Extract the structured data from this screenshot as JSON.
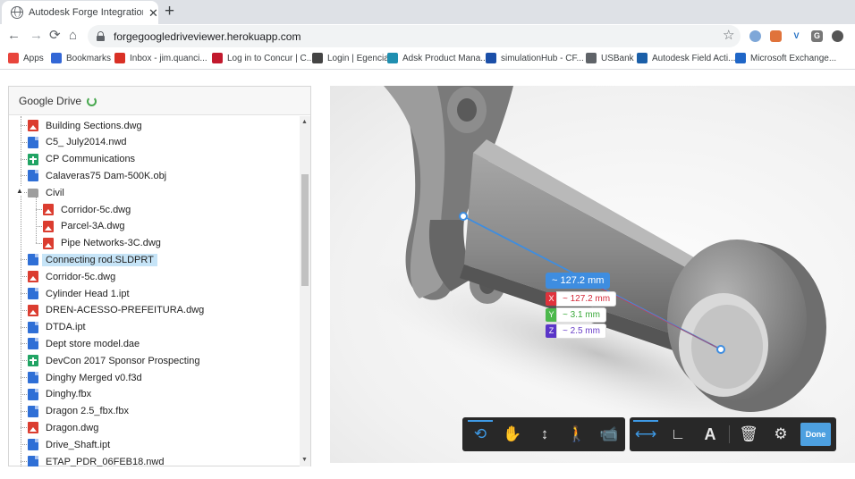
{
  "browser": {
    "tab_title": "Autodesk Forge Integration with",
    "close_glyph": "✕",
    "new_tab_glyph": "+",
    "url": "forgegoogledriveviewer.herokuapp.com",
    "nav": {
      "back": "←",
      "forward": "→",
      "reload": "⟳",
      "home": "⌂",
      "star": "☆"
    },
    "extensions": [
      {
        "icon": "extension-circle-icon",
        "letter": "",
        "color": "#7ea7d8"
      },
      {
        "icon": "extension-fox-icon",
        "letter": "",
        "color": "#e0733b"
      },
      {
        "icon": "extension-v-icon",
        "letter": "V",
        "color": "#1f6ec4"
      },
      {
        "icon": "extension-g-icon",
        "letter": "G",
        "color": "#777777"
      },
      {
        "icon": "extension-dot-icon",
        "letter": "",
        "color": "#555555"
      }
    ]
  },
  "bookmarks": [
    {
      "label": "Apps",
      "icon": "apps-grid-icon",
      "color": "#e8453c"
    },
    {
      "label": "Bookmarks",
      "icon": "star-icon",
      "color": "#3367d6"
    },
    {
      "label": "Inbox - jim.quanci...",
      "icon": "gmail-icon",
      "color": "#d93025"
    },
    {
      "label": "Log in to Concur | C...",
      "icon": "concur-icon",
      "color": "#c2192d"
    },
    {
      "label": "Login | Egencia",
      "icon": "egencia-icon",
      "color": "#444444"
    },
    {
      "label": "Adsk Product Mana...",
      "icon": "cube-icon",
      "color": "#1f8fb0"
    },
    {
      "label": "simulationHub - CF...",
      "icon": "simulationhub-icon",
      "color": "#1b4fa8"
    },
    {
      "label": "USBank",
      "icon": "globe-icon",
      "color": "#5f6368"
    },
    {
      "label": "Autodesk Field Acti...",
      "icon": "field-icon",
      "color": "#1b5fa8"
    },
    {
      "label": "Microsoft Exchange...",
      "icon": "exchange-icon",
      "color": "#1f66c7"
    }
  ],
  "drive_panel": {
    "title": "Google Drive",
    "files": [
      {
        "name": "Building Sections.dwg",
        "type": "img",
        "level": 0
      },
      {
        "name": "C5_ July2014.nwd",
        "type": "doc",
        "level": 0
      },
      {
        "name": "CP Communications",
        "type": "sheet",
        "level": 0
      },
      {
        "name": "Calaveras75 Dam-500K.obj",
        "type": "doc",
        "level": 0
      },
      {
        "name": "Civil",
        "type": "folder",
        "level": 0
      },
      {
        "name": "Corridor-5c.dwg",
        "type": "img",
        "level": 1
      },
      {
        "name": "Parcel-3A.dwg",
        "type": "img",
        "level": 1
      },
      {
        "name": "Pipe Networks-3C.dwg",
        "type": "img",
        "level": 1
      },
      {
        "name": "Connecting rod.SLDPRT",
        "type": "doc",
        "level": 0,
        "selected": true
      },
      {
        "name": "Corridor-5c.dwg",
        "type": "img",
        "level": 0
      },
      {
        "name": "Cylinder Head 1.ipt",
        "type": "doc",
        "level": 0
      },
      {
        "name": "DREN-ACESSO-PREFEITURA.dwg",
        "type": "img",
        "level": 0
      },
      {
        "name": "DTDA.ipt",
        "type": "doc",
        "level": 0
      },
      {
        "name": "Dept store model.dae",
        "type": "doc",
        "level": 0
      },
      {
        "name": "DevCon 2017 Sponsor Prospecting",
        "type": "sheet",
        "level": 0
      },
      {
        "name": "Dinghy Merged v0.f3d",
        "type": "doc",
        "level": 0
      },
      {
        "name": "Dinghy.fbx",
        "type": "doc",
        "level": 0
      },
      {
        "name": "Dragon 2.5_fbx.fbx",
        "type": "doc",
        "level": 0
      },
      {
        "name": "Dragon.dwg",
        "type": "img",
        "level": 0
      },
      {
        "name": "Drive_Shaft.ipt",
        "type": "doc",
        "level": 0
      },
      {
        "name": "ETAP_PDR_06FEB18.nwd",
        "type": "doc",
        "level": 0
      }
    ]
  },
  "measurement": {
    "total": "~ 127.2 mm",
    "axes": [
      {
        "axis": "X",
        "value": "~ 127.2 mm",
        "tag_color": "#e0323c",
        "text_color": "#d42a3a"
      },
      {
        "axis": "Y",
        "value": "~ 3.1 mm",
        "tag_color": "#4cb84c",
        "text_color": "#3aa83a"
      },
      {
        "axis": "Z",
        "value": "~ 2.5 mm",
        "tag_color": "#5a35c8",
        "text_color": "#6a3fc8"
      }
    ]
  },
  "toolbar_nav": [
    {
      "name": "orbit-tool",
      "icon": "orbit-icon",
      "glyph": "⟲",
      "active": true
    },
    {
      "name": "pan-tool",
      "icon": "hand-icon",
      "glyph": "✋",
      "active": false
    },
    {
      "name": "zoom-tool",
      "icon": "zoom-arrows-icon",
      "glyph": "↕",
      "active": false
    },
    {
      "name": "first-person-tool",
      "icon": "person-icon",
      "glyph": "🚶",
      "active": false
    },
    {
      "name": "camera-tool",
      "icon": "camera-icon",
      "glyph": "📹",
      "active": false
    }
  ],
  "toolbar_measure": [
    {
      "name": "measure-distance-tool",
      "icon": "ruler-distance-icon",
      "glyph": "⟷",
      "active": true
    },
    {
      "name": "measure-angle-tool",
      "icon": "angle-icon",
      "glyph": "∟",
      "active": false
    },
    {
      "name": "measure-area-tool",
      "icon": "area-icon",
      "glyph": "A",
      "active": false
    },
    {
      "name": "delete-measurement-tool",
      "icon": "trash-icon",
      "glyph": "🗑",
      "active": false
    },
    {
      "name": "measure-settings-tool",
      "icon": "settings-icon",
      "glyph": "⚙",
      "active": false
    }
  ],
  "done_label": "Done"
}
